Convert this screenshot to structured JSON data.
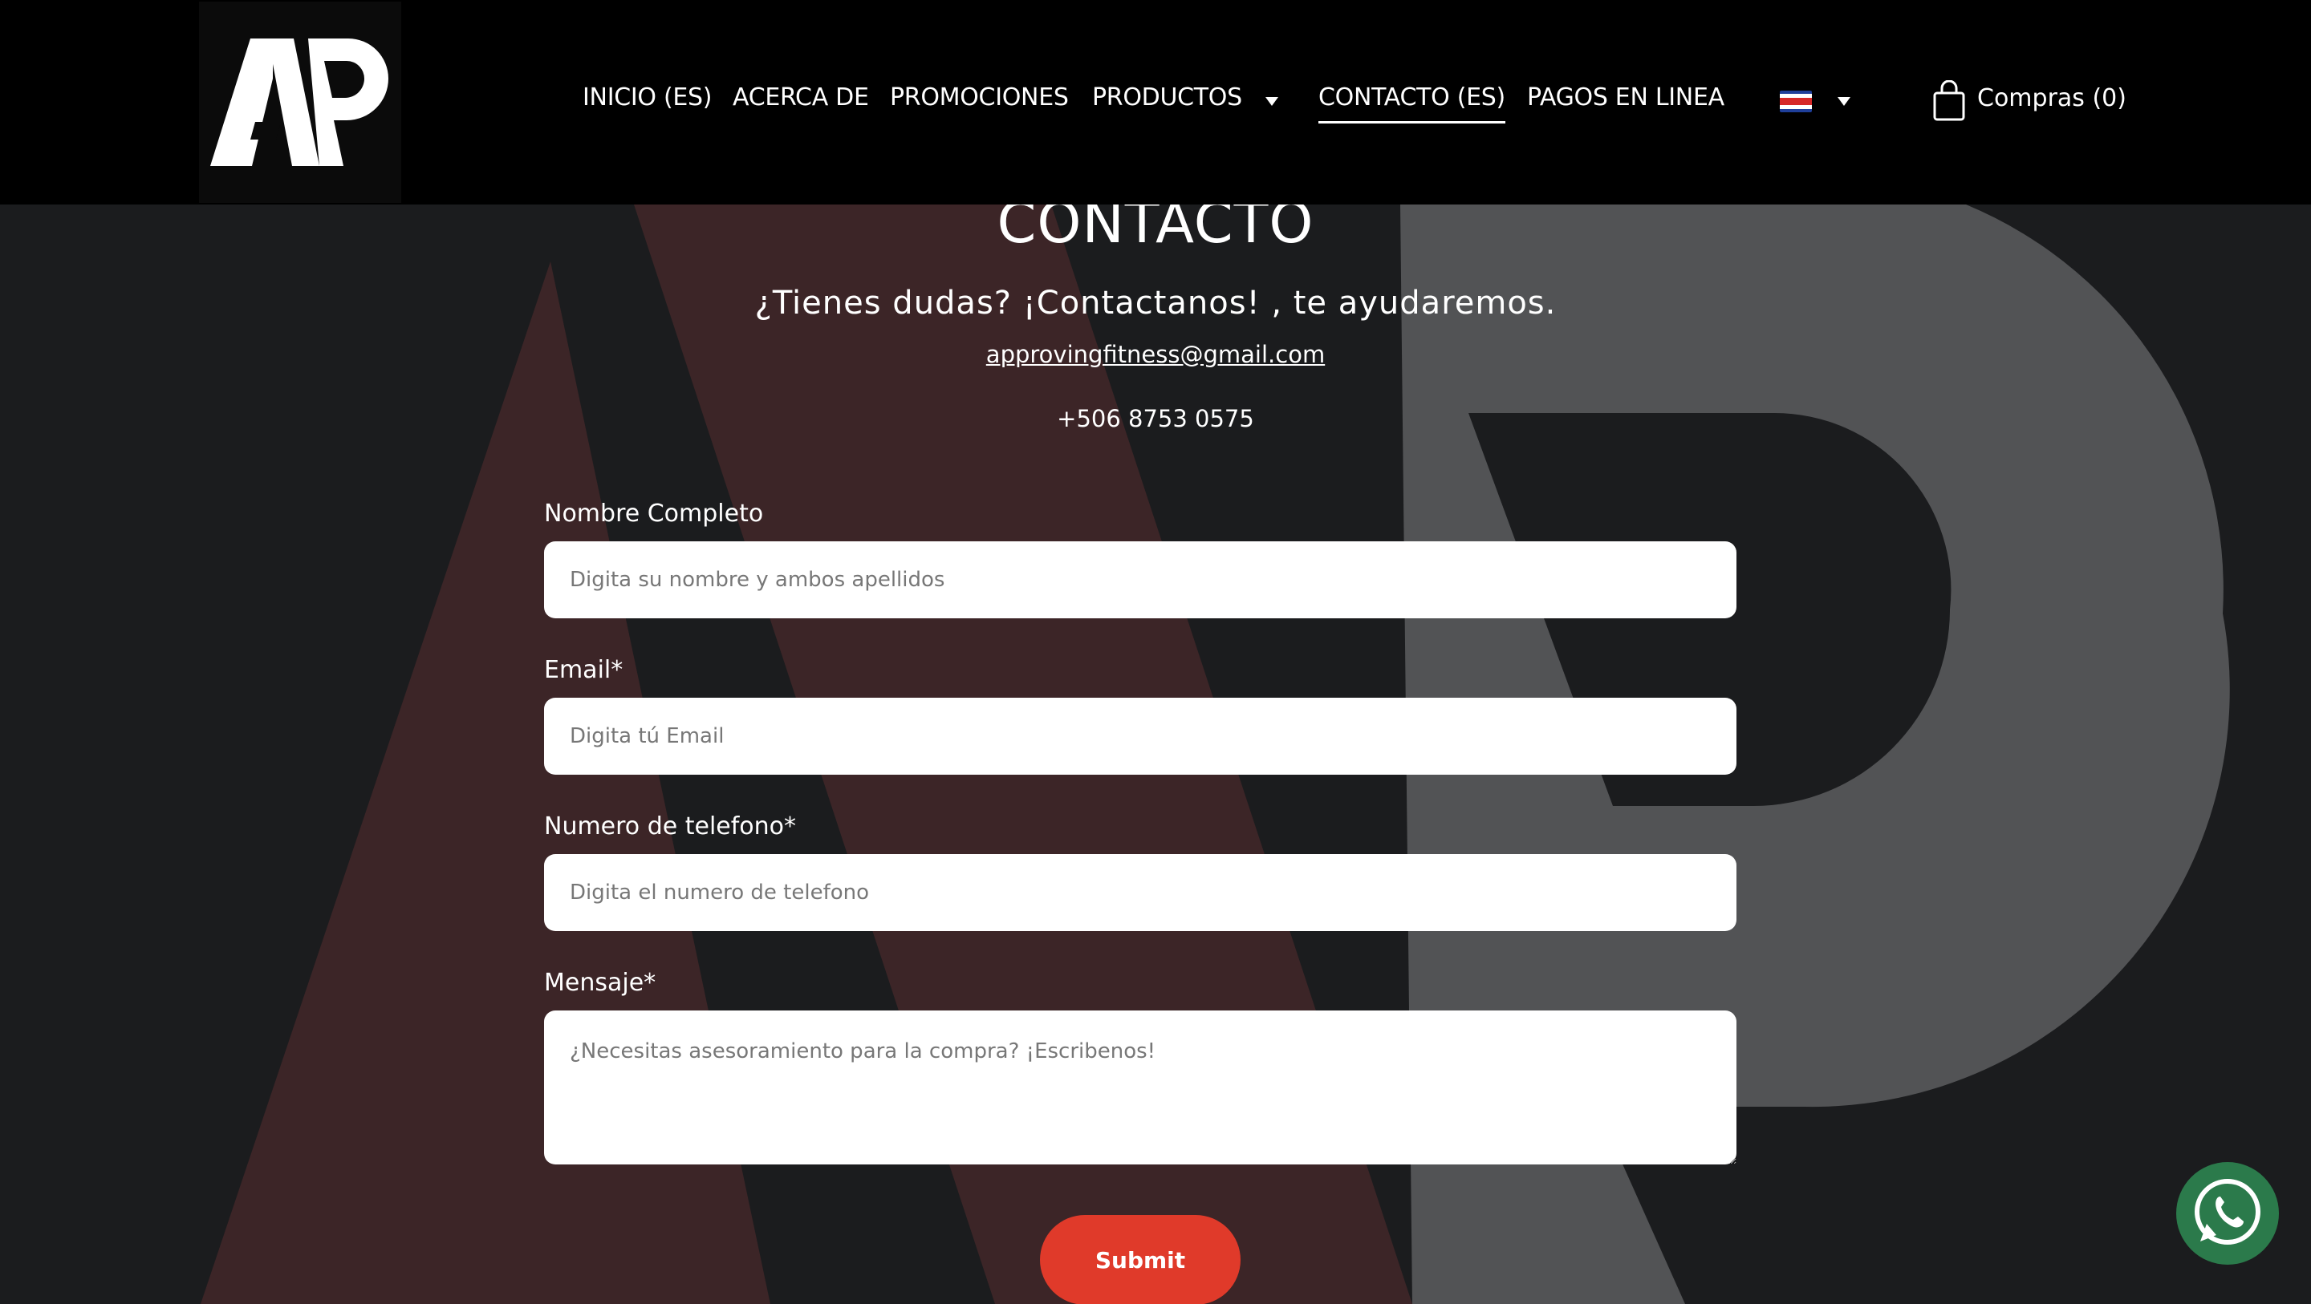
{
  "header": {
    "nav": [
      {
        "label": "INICIO (ES)"
      },
      {
        "label": "ACERCA DE"
      },
      {
        "label": "PROMOCIONES"
      },
      {
        "label": "PRODUCTOS"
      },
      {
        "label": "CONTACTO (ES)",
        "active": true
      },
      {
        "label": "PAGOS EN LINEA"
      }
    ],
    "cart_label": "Compras (0)"
  },
  "main": {
    "title": "CONTACTO",
    "subtitle": "¿Tienes dudas?  ¡Contactanos! , te ayudaremos.",
    "email": "approvingfitness@gmail.com",
    "phone": "+506 8753 0575"
  },
  "form": {
    "name_label": "Nombre Completo",
    "name_placeholder": "Digita su nombre y ambos apellidos",
    "email_label": "Email*",
    "email_placeholder": "Digita tú Email",
    "phone_label": "Numero de telefono*",
    "phone_placeholder": "Digita el numero de telefono",
    "message_label": "Mensaje*",
    "message_placeholder": "¿Necesitas asesoramiento para la compra? ¡Escribenos!",
    "submit_label": "Submit"
  },
  "colors": {
    "header_bg": "#000000",
    "page_bg": "#1b1c1e",
    "accent": "#e03a2a",
    "whatsapp": "#2b7a4b"
  },
  "icons": [
    "cart-icon",
    "flag-cr-icon",
    "chevron-down-icon",
    "whatsapp-icon"
  ]
}
